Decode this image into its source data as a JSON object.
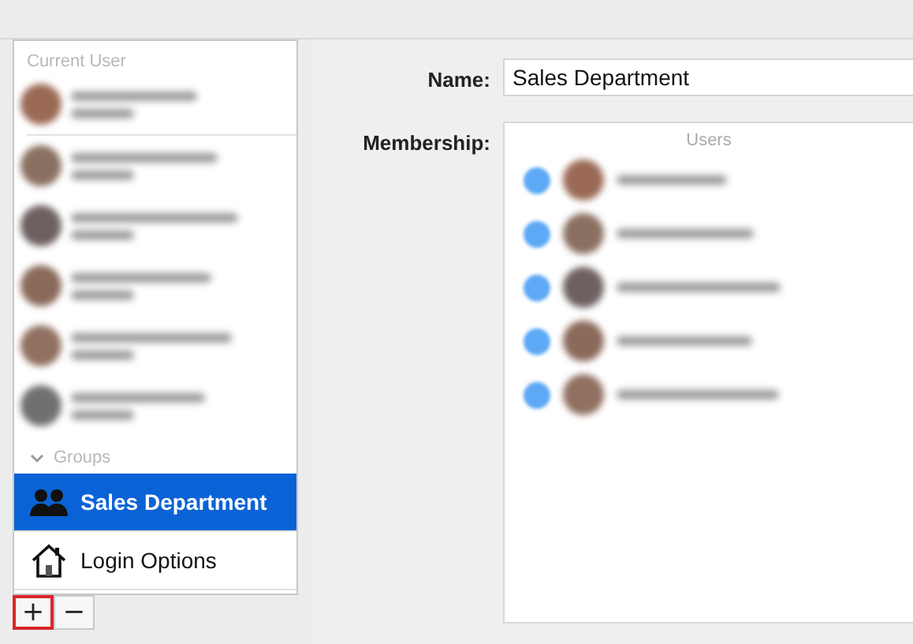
{
  "sidebar": {
    "current_user_label": "Current User",
    "current_user": {
      "kind": "redacted"
    },
    "users": [
      {
        "kind": "redacted"
      },
      {
        "kind": "redacted"
      },
      {
        "kind": "redacted"
      },
      {
        "kind": "redacted"
      },
      {
        "kind": "redacted"
      }
    ],
    "groups_label": "Groups",
    "groups_expanded": true,
    "items": [
      {
        "kind": "group",
        "label": "Sales Department",
        "selected": true
      },
      {
        "kind": "home",
        "label": "Login Options",
        "selected": false
      }
    ],
    "buttons": [
      {
        "label": "+",
        "highlighted": true
      },
      {
        "label": "−",
        "highlighted": false
      }
    ]
  },
  "detail": {
    "name_label": "Name:",
    "name_value": "Sales Department",
    "membership_label": "Membership:",
    "list_header": "Users",
    "members": [
      {
        "checked": true
      },
      {
        "checked": true
      },
      {
        "checked": true
      },
      {
        "checked": true
      },
      {
        "checked": true
      }
    ]
  }
}
